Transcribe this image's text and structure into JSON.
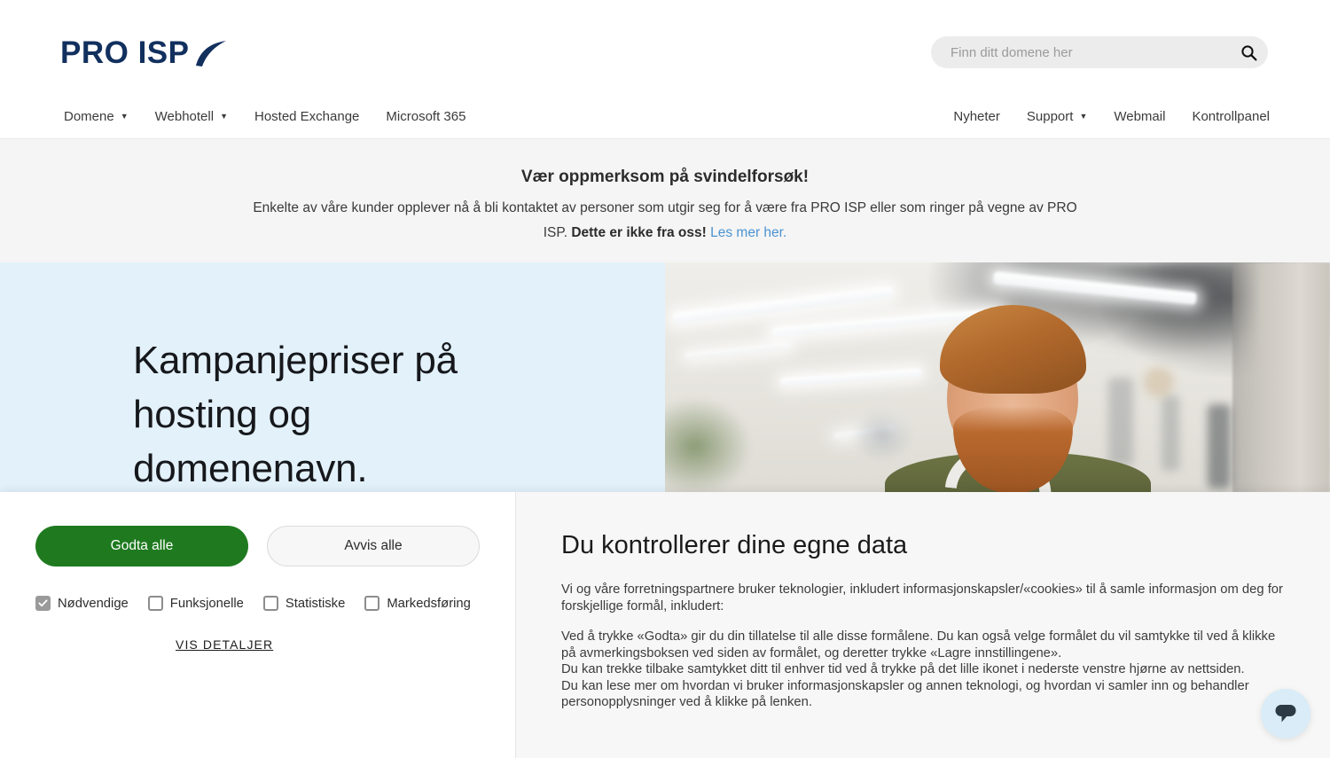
{
  "header": {
    "logo_text": "PRO ISP",
    "logo_color": "#12305e",
    "search": {
      "placeholder": "Finn ditt domene her",
      "value": "",
      "icon": "search-icon"
    }
  },
  "nav": {
    "left_items": [
      {
        "label": "Domene",
        "caret": "▼"
      },
      {
        "label": "Webhotell",
        "caret": "▼"
      },
      {
        "label": "Hosted Exchange",
        "caret": ""
      },
      {
        "label": "Microsoft 365",
        "caret": ""
      }
    ],
    "right_items": [
      {
        "label": "Nyheter",
        "caret": ""
      },
      {
        "label": "Support",
        "caret": "▼"
      },
      {
        "label": "Webmail",
        "caret": ""
      },
      {
        "label": "Kontrollpanel",
        "caret": ""
      }
    ]
  },
  "warning_banner": {
    "title": "Vær oppmerksom på svindelforsøk!",
    "body_line1": "Enkelte av våre kunder opplever nå å bli kontaktet av personer som utgir seg for å være fra PRO ISP eller som ringer på",
    "body_line2_prefix": "vegne av PRO ISP. ",
    "body_bold": "Dette er ikke fra oss!",
    "link_text": "Les mer her.",
    "link_color": "#4b93d1",
    "background": "#f5f5f5"
  },
  "hero": {
    "title": "Kampanjepriser på hosting og domenenavn.",
    "background": "#e3f1fa",
    "image_alt": "smiling-man-with-headphones-in-office"
  },
  "cookie_banner": {
    "accept_button": "Godta alle",
    "accept_color": "#1f7a1f",
    "reject_button": "Avvis alle",
    "checkboxes": [
      {
        "label": "Nødvendige",
        "checked": true
      },
      {
        "label": "Funksjonelle",
        "checked": false
      },
      {
        "label": "Statistiske",
        "checked": false
      },
      {
        "label": "Markedsføring",
        "checked": false
      }
    ],
    "details_link": "VIS DETALJER",
    "title": "Du kontrollerer dine egne data",
    "paragraph1": "Vi og våre forretningspartnere bruker teknologier, inkludert informasjonskapsler/«cookies» til å samle informasjon om deg for forskjellige formål, inkludert:",
    "paragraph2": "Ved å trykke «Godta» gir du din tillatelse til alle disse formålene. Du kan også velge formålet du vil samtykke til ved å klikke på avmerkingsboksen ved siden av formålet, og deretter trykke «Lagre innstillingene».",
    "paragraph3": "Du kan trekke tilbake samtykket ditt til enhver tid ved å trykke på det lille ikonet i nederste venstre hjørne av nettsiden.",
    "paragraph4": "Du kan lese mer om hvordan vi bruker informasjonskapsler og annen teknologi, og hvordan vi samler inn og behandler personopplysninger ved å klikke på lenken."
  },
  "chat_widget": {
    "icon": "chat-bubble-icon",
    "background": "#d9ecf7",
    "icon_color": "#2b3a44"
  }
}
